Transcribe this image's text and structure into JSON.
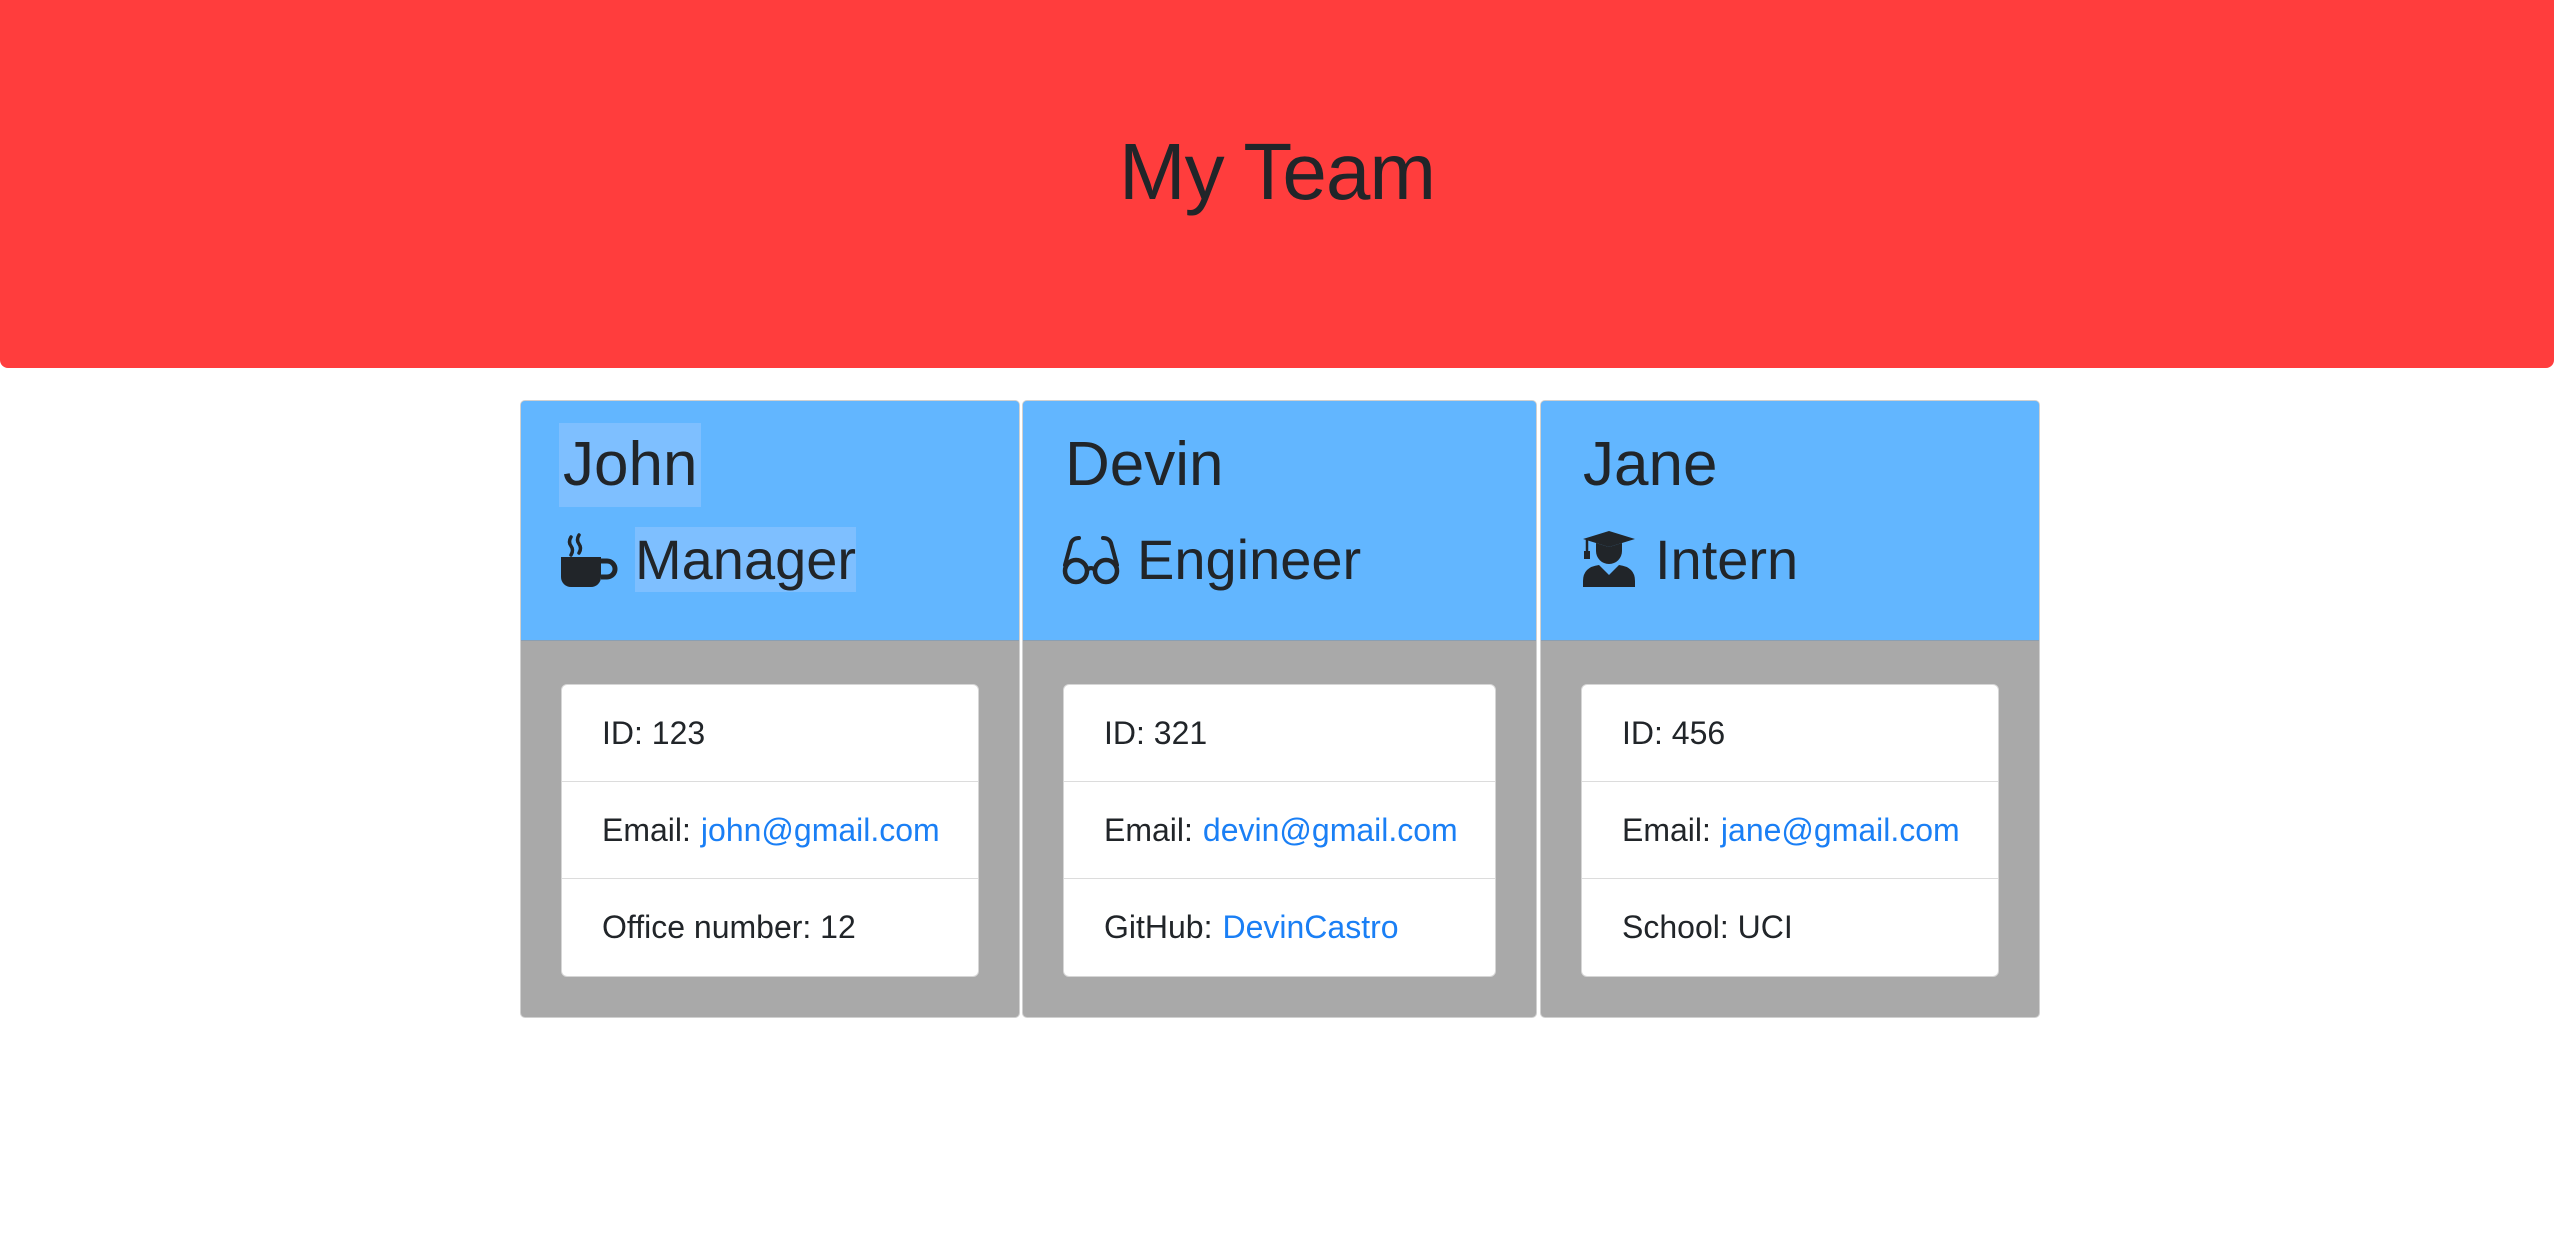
{
  "header": {
    "title": "My Team",
    "background": "#ff3d3d"
  },
  "employees": [
    {
      "name": "John",
      "role": "Manager",
      "role_icon": "coffee-icon",
      "id_label": "ID:",
      "id": "123",
      "email_label": "Email:",
      "email": "john@gmail.com",
      "extra_label": "Office number:",
      "extra_value": "12"
    },
    {
      "name": "Devin",
      "role": "Engineer",
      "role_icon": "glasses-icon",
      "id_label": "ID:",
      "id": "321",
      "email_label": "Email:",
      "email": "devin@gmail.com",
      "extra_label": "GitHub:",
      "extra_value": "DevinCastro"
    },
    {
      "name": "Jane",
      "role": "Intern",
      "role_icon": "graduate-icon",
      "id_label": "ID:",
      "id": "456",
      "email_label": "Email:",
      "email": "jane@gmail.com",
      "extra_label": "School:",
      "extra_value": "UCI"
    }
  ],
  "colors": {
    "card_header": "#62b6ff",
    "card_body": "#a9a9a9",
    "link": "#1a7ff5"
  }
}
